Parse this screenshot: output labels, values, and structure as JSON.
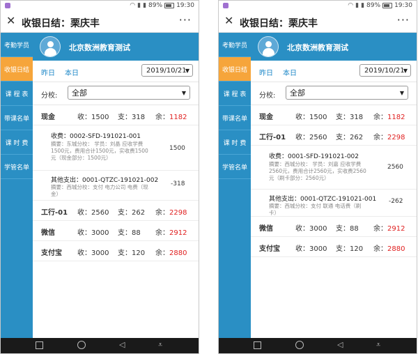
{
  "status": {
    "battery": "89%",
    "time": "19:30"
  },
  "title": "收银日结：栗庆丰",
  "more_glyph": "···",
  "close_glyph": "✕",
  "sidebar": [
    {
      "label": "考勤学员"
    },
    {
      "label": "收银日结"
    },
    {
      "label": "课 程 表"
    },
    {
      "label": "带课名单"
    },
    {
      "label": "课 时 费"
    },
    {
      "label": "学管名单"
    }
  ],
  "org": "北京数洲教育测试",
  "date": {
    "yesterday": "昨日",
    "today": "本日",
    "value": "2019/10/21"
  },
  "branch": {
    "label": "分校:",
    "value": "全部"
  },
  "labels": {
    "income": "收：",
    "expense": "支：",
    "balance": "余："
  },
  "left": {
    "cash": {
      "name": "现金",
      "income": "1500",
      "expense": "318",
      "balance": "1182"
    },
    "details": [
      {
        "title": "收费：0002-SFD-191021-001",
        "summary": "摘要：东城分校：  学员：刘晶 应收学费1500元，费用合计1500元，实收费1500元（现金部分：1500元）",
        "amount": "1500"
      },
      {
        "title": "其他支出：0001-QTZC-191021-002",
        "summary": "摘要：西城分校：支付 电力公司 电费（现金）",
        "amount": "-318"
      }
    ],
    "others": [
      {
        "name": "工行-01",
        "income": "2560",
        "expense": "262",
        "balance": "2298"
      },
      {
        "name": "微信",
        "income": "3000",
        "expense": "88",
        "balance": "2912"
      },
      {
        "name": "支付宝",
        "income": "3000",
        "expense": "120",
        "balance": "2880"
      }
    ]
  },
  "right": {
    "cash": {
      "name": "现金",
      "income": "1500",
      "expense": "318",
      "balance": "1182"
    },
    "icbc": {
      "name": "工行-01",
      "income": "2560",
      "expense": "262",
      "balance": "2298"
    },
    "details": [
      {
        "title": "收费：0001-SFD-191021-002",
        "summary": "摘要：西城分校：  学员：刘嘉 应收学费2560元，费用合计2560元，实收费2560元（刷卡部分：2560元）",
        "amount": "2560"
      },
      {
        "title": "其他支出：0001-QTZC-191021-001",
        "summary": "摘要：西城分校：支付 联通 电话费（刷卡）",
        "amount": "-262"
      }
    ],
    "others": [
      {
        "name": "微信",
        "income": "3000",
        "expense": "88",
        "balance": "2912"
      },
      {
        "name": "支付宝",
        "income": "3000",
        "expense": "120",
        "balance": "2880"
      }
    ]
  },
  "nav_icons": [
    "square-icon",
    "circle-icon",
    "triangle-back-icon",
    "menu-down-icon"
  ]
}
